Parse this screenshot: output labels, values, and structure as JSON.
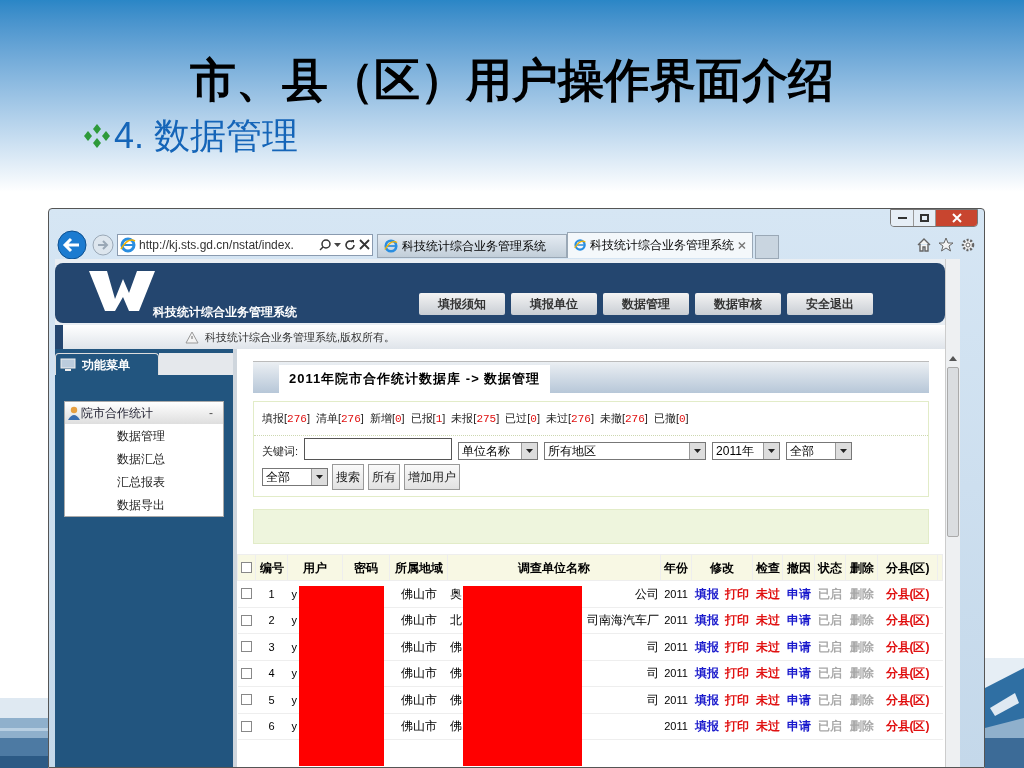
{
  "slide": {
    "title": "市、县（区）用户操作界面介绍",
    "subtitle": "4. 数据管理"
  },
  "browser": {
    "address": "http://kj.sts.gd.cn/nstat/index.",
    "tabs": [
      {
        "label": "科技统计综合业务管理系统",
        "selected": false
      },
      {
        "label": "科技统计综合业务管理系统",
        "selected": true
      }
    ]
  },
  "header": {
    "system_name": "科技统计综合业务管理系统",
    "nav": [
      "填报须知",
      "填报单位",
      "数据管理",
      "数据审核",
      "安全退出"
    ]
  },
  "notice": "科技统计综合业务管理系统,版权所有。",
  "sidebar": {
    "title": "功能菜单",
    "group": {
      "label": "院市合作统计",
      "toggle": "-",
      "expanded": true,
      "children": [
        "数据管理",
        "数据汇总",
        "汇总报表",
        "数据导出"
      ]
    }
  },
  "breadcrumb": "2011年院市合作统计数据库 -> 数据管理",
  "stats": [
    {
      "label": "填报[",
      "count": "276",
      "suffix": "]"
    },
    {
      "label": "清单[",
      "count": "276",
      "suffix": "]"
    },
    {
      "label": "新增[",
      "count": "0",
      "suffix": "]"
    },
    {
      "label": "已报[",
      "count": "1",
      "suffix": "]"
    },
    {
      "label": "未报[",
      "count": "275",
      "suffix": "]"
    },
    {
      "label": "已过[",
      "count": "0",
      "suffix": "]"
    },
    {
      "label": "未过[",
      "count": "276",
      "suffix": "]"
    },
    {
      "label": "未撤[",
      "count": "276",
      "suffix": "]"
    },
    {
      "label": "已撤[",
      "count": "0",
      "suffix": "]"
    }
  ],
  "search": {
    "keyword_label": "关键词:",
    "selects": [
      "单位名称",
      "所有地区",
      "2011年",
      "全部",
      "全部"
    ],
    "buttons": [
      "搜索",
      "所有",
      "增加用户"
    ]
  },
  "table": {
    "columns": [
      "编号",
      "用户",
      "密码",
      "所属地域",
      "调查单位名称",
      "年份",
      "修改",
      "检查",
      "撤因",
      "状态",
      "删除",
      "分县(区)"
    ],
    "select_all_checked": false,
    "rows": [
      {
        "no": "1",
        "checked": false,
        "user": "y",
        "region": "佛山市",
        "name_start": "奥",
        "name_end": "公司",
        "year": "2011",
        "actions": [
          {
            "text": "填报",
            "color": "#1a1acc"
          },
          {
            "text": "打印",
            "color": "#e01010"
          },
          {
            "text": "未过",
            "color": "#e01010"
          },
          {
            "text": "申请",
            "color": "#1a1acc"
          },
          {
            "text": "已启",
            "color": "#a8a8a8"
          },
          {
            "text": "删除",
            "color": "#a8a8a8"
          },
          {
            "text": "分县(区)",
            "color": "#e01010"
          }
        ]
      },
      {
        "no": "2",
        "checked": false,
        "user": "y",
        "region": "佛山市",
        "name_start": "北",
        "name_end": "司南海汽车厂",
        "year": "2011",
        "actions": [
          {
            "text": "填报",
            "color": "#1a1acc"
          },
          {
            "text": "打印",
            "color": "#e01010"
          },
          {
            "text": "未过",
            "color": "#e01010"
          },
          {
            "text": "申请",
            "color": "#1a1acc"
          },
          {
            "text": "已启",
            "color": "#a8a8a8"
          },
          {
            "text": "删除",
            "color": "#a8a8a8"
          },
          {
            "text": "分县(区)",
            "color": "#e01010"
          }
        ]
      },
      {
        "no": "3",
        "checked": false,
        "user": "y",
        "region": "佛山市",
        "name_start": "佛",
        "name_end": "司",
        "year": "2011",
        "actions": [
          {
            "text": "填报",
            "color": "#1a1acc"
          },
          {
            "text": "打印",
            "color": "#e01010"
          },
          {
            "text": "未过",
            "color": "#e01010"
          },
          {
            "text": "申请",
            "color": "#1a1acc"
          },
          {
            "text": "已启",
            "color": "#a8a8a8"
          },
          {
            "text": "删除",
            "color": "#a8a8a8"
          },
          {
            "text": "分县(区)",
            "color": "#e01010"
          }
        ]
      },
      {
        "no": "4",
        "checked": false,
        "user": "y",
        "region": "佛山市",
        "name_start": "佛",
        "name_end": "司",
        "year": "2011",
        "actions": [
          {
            "text": "填报",
            "color": "#1a1acc"
          },
          {
            "text": "打印",
            "color": "#e01010"
          },
          {
            "text": "未过",
            "color": "#e01010"
          },
          {
            "text": "申请",
            "color": "#1a1acc"
          },
          {
            "text": "已启",
            "color": "#a8a8a8"
          },
          {
            "text": "删除",
            "color": "#a8a8a8"
          },
          {
            "text": "分县(区)",
            "color": "#e01010"
          }
        ]
      },
      {
        "no": "5",
        "checked": false,
        "user": "y",
        "region": "佛山市",
        "name_start": "佛",
        "name_end": "司",
        "year": "2011",
        "actions": [
          {
            "text": "填报",
            "color": "#1a1acc"
          },
          {
            "text": "打印",
            "color": "#e01010"
          },
          {
            "text": "未过",
            "color": "#e01010"
          },
          {
            "text": "申请",
            "color": "#1a1acc"
          },
          {
            "text": "已启",
            "color": "#a8a8a8"
          },
          {
            "text": "删除",
            "color": "#a8a8a8"
          },
          {
            "text": "分县(区)",
            "color": "#e01010"
          }
        ]
      },
      {
        "no": "6",
        "checked": false,
        "user": "y",
        "region": "佛山市",
        "name_start": "佛",
        "year": "2011",
        "actions": [
          {
            "text": "填报",
            "color": "#1a1acc"
          },
          {
            "text": "打印",
            "color": "#e01010"
          },
          {
            "text": "未过",
            "color": "#e01010"
          },
          {
            "text": "申请",
            "color": "#1a1acc"
          },
          {
            "text": "已启",
            "color": "#a8a8a8"
          },
          {
            "text": "删除",
            "color": "#a8a8a8"
          },
          {
            "text": "分县(区)",
            "color": "#e01010"
          }
        ]
      }
    ]
  }
}
